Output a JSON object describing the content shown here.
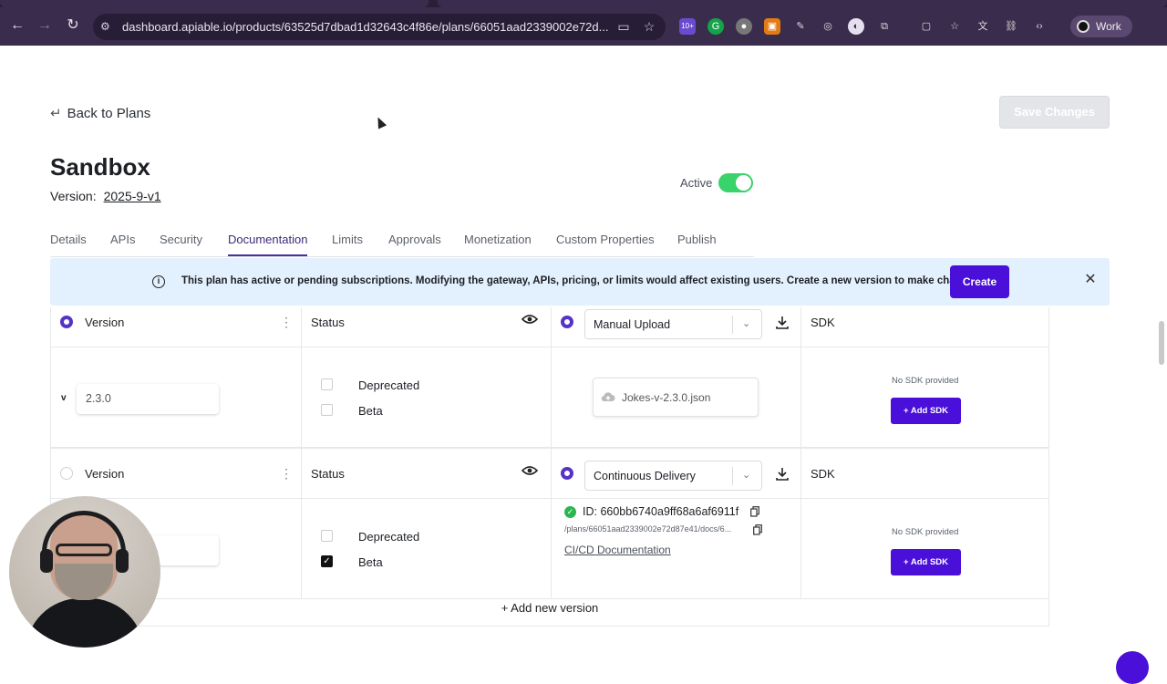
{
  "browser": {
    "url": "dashboard.apiable.io/products/63525d7dbad1d32643c4f86e/plans/66051aad2339002e72d...",
    "profile_label": "Work",
    "ext_badge": "10+"
  },
  "header": {
    "back_label": "Back to Plans",
    "save_label": "Save Changes",
    "title": "Sandbox",
    "version_label": "Version:",
    "version_value": "2025-9-v1",
    "active_label": "Active"
  },
  "tabs": [
    "Details",
    "APIs",
    "Security",
    "Documentation",
    "Limits",
    "Approvals",
    "Monetization",
    "Custom Properties",
    "Publish"
  ],
  "banner": {
    "message": "This plan has active or pending subscriptions. Modifying the gateway, APIs, pricing, or limits would affect existing users. Create a new version to make changes.",
    "create_label": "Create"
  },
  "table": {
    "rows": [
      {
        "version_header": "Version",
        "status_header": "Status",
        "source_select": "Manual Upload",
        "sdk_header": "SDK",
        "version_value": "2.3.0",
        "caret": "v",
        "deprecated_label": "Deprecated",
        "beta_label": "Beta",
        "file_name": "Jokes-v-2.3.0.json",
        "no_sdk": "No SDK provided",
        "add_sdk": "+ Add SDK"
      },
      {
        "version_header": "Version",
        "status_header": "Status",
        "source_select": "Continuous Delivery",
        "sdk_header": "SDK",
        "deprecated_label": "Deprecated",
        "beta_label": "Beta",
        "ci_id": "ID: 660bb6740a9ff68a6af6911f",
        "ci_path": "/plans/66051aad2339002e72d87e41/docs/6...",
        "ci_doc_link": "CI/CD Documentation",
        "no_sdk": "No SDK provided",
        "add_sdk": "+ Add SDK"
      }
    ],
    "add_version_label": "+ Add new version"
  }
}
